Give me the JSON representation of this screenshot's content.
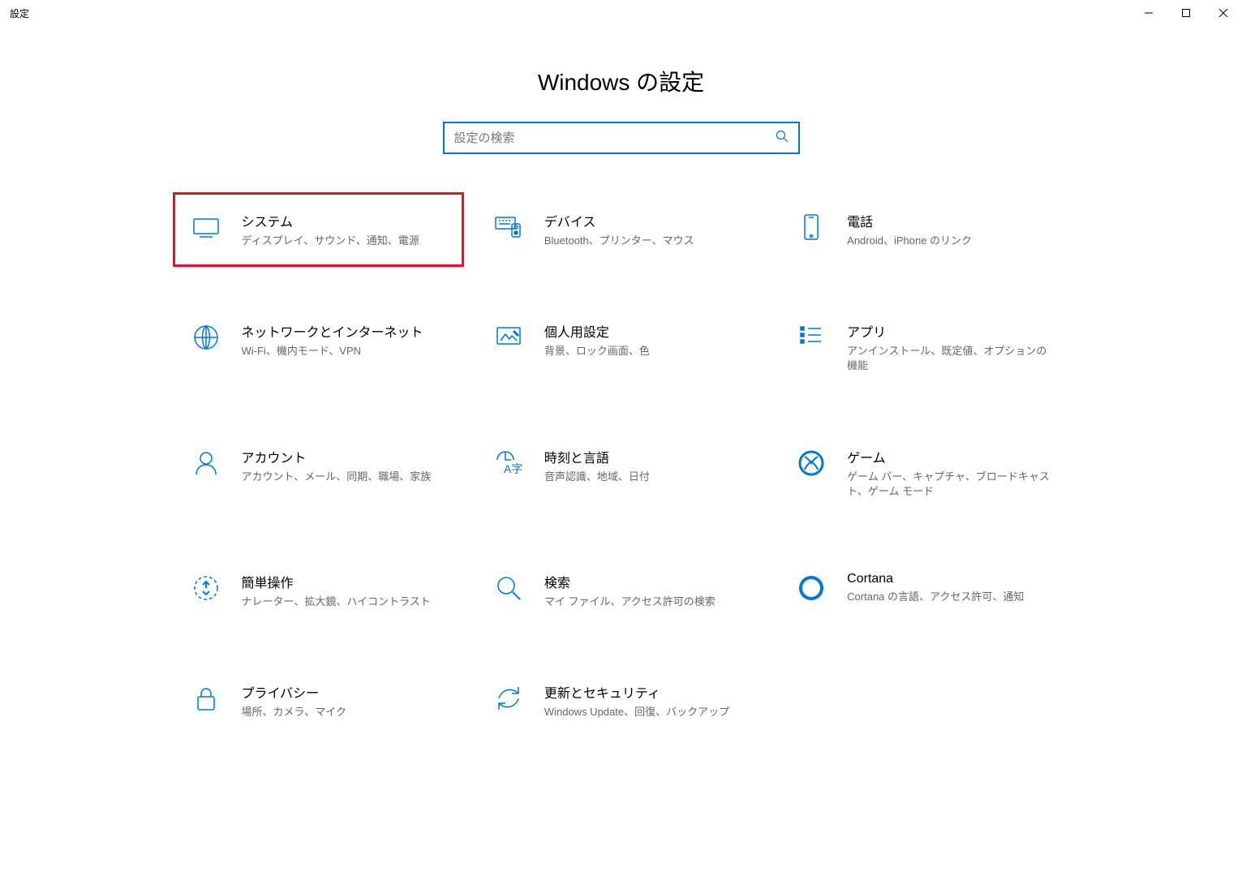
{
  "window": {
    "title": "設定"
  },
  "header": {
    "title": "Windows の設定"
  },
  "search": {
    "placeholder": "設定の検索"
  },
  "items": [
    {
      "title": "システム",
      "desc": "ディスプレイ、サウンド、通知、電源"
    },
    {
      "title": "デバイス",
      "desc": "Bluetooth、プリンター、マウス"
    },
    {
      "title": "電話",
      "desc": "Android、iPhone のリンク"
    },
    {
      "title": "ネットワークとインターネット",
      "desc": "Wi-Fi、機内モード、VPN"
    },
    {
      "title": "個人用設定",
      "desc": "背景、ロック画面、色"
    },
    {
      "title": "アプリ",
      "desc": "アンインストール、既定値、オプションの機能"
    },
    {
      "title": "アカウント",
      "desc": "アカウント、メール、同期、職場、家族"
    },
    {
      "title": "時刻と言語",
      "desc": "音声認識、地域、日付"
    },
    {
      "title": "ゲーム",
      "desc": "ゲーム バー、キャプチャ、ブロードキャスト、ゲーム モード"
    },
    {
      "title": "簡単操作",
      "desc": "ナレーター、拡大鏡、ハイコントラスト"
    },
    {
      "title": "検索",
      "desc": "マイ ファイル、アクセス許可の検索"
    },
    {
      "title": "Cortana",
      "desc": "Cortana の言語、アクセス許可、通知"
    },
    {
      "title": "プライバシー",
      "desc": "場所、カメラ、マイク"
    },
    {
      "title": "更新とセキュリティ",
      "desc": "Windows Update、回復、バックアップ"
    }
  ]
}
